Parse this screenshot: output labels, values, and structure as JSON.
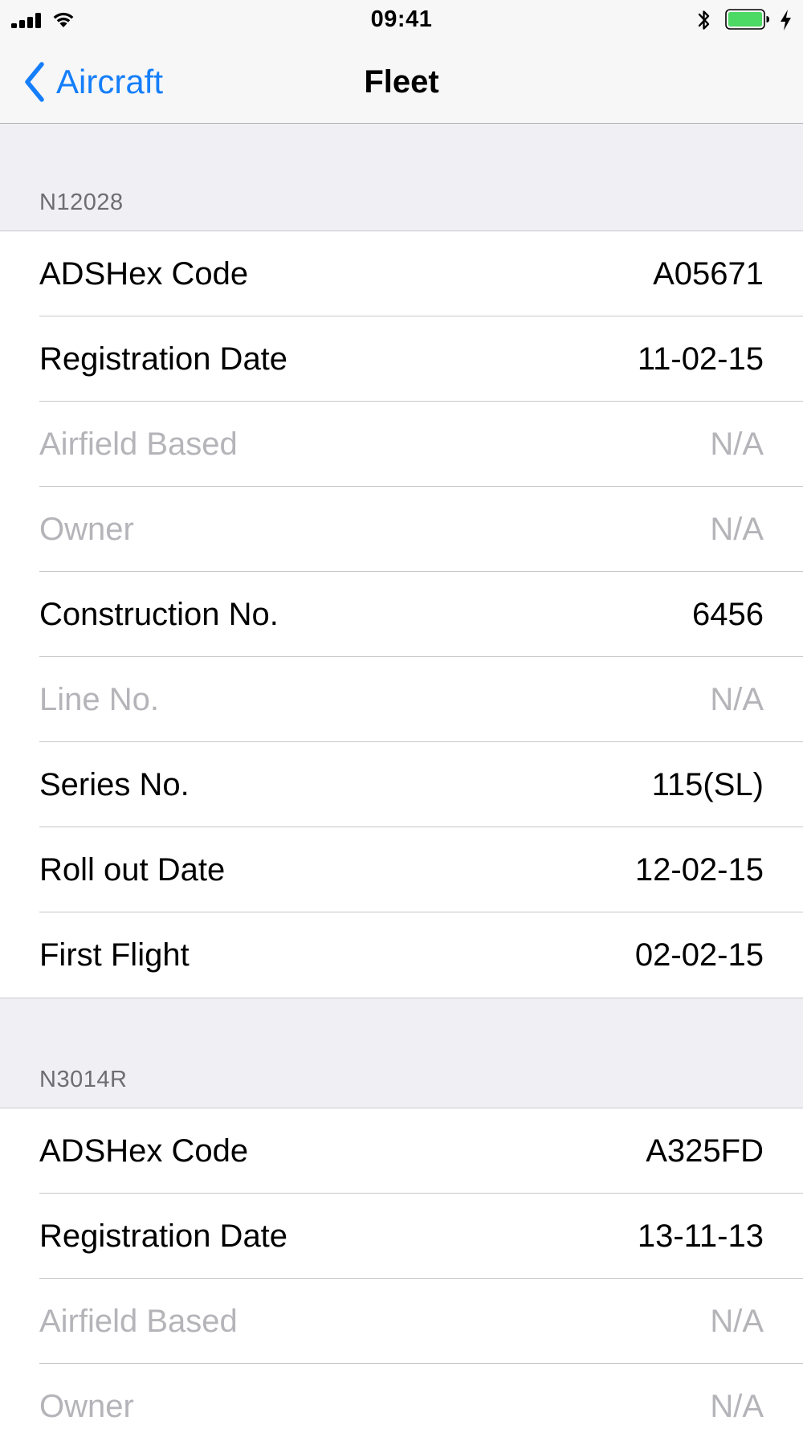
{
  "status_bar": {
    "time": "09:41"
  },
  "nav": {
    "back_label": "Aircraft",
    "title": "Fleet"
  },
  "colors": {
    "accent": "#157efb",
    "battery": "#4cd964",
    "background": "#efeff4",
    "disabled_text": "#b4b4b9"
  },
  "icons": [
    "signal-icon",
    "wifi-icon",
    "bluetooth-icon",
    "battery-icon",
    "charging-icon",
    "back-chevron-icon"
  ],
  "sections": [
    {
      "title": "N12028",
      "rows": [
        {
          "label": "ADSHex Code",
          "value": "A05671"
        },
        {
          "label": "Registration Date",
          "value": "11-02-15"
        },
        {
          "label": "Airfield Based",
          "value": "N/A"
        },
        {
          "label": "Owner",
          "value": "N/A"
        },
        {
          "label": "Construction No.",
          "value": "6456"
        },
        {
          "label": "Line No.",
          "value": "N/A"
        },
        {
          "label": "Series No.",
          "value": "115(SL)"
        },
        {
          "label": "Roll out Date",
          "value": "12-02-15"
        },
        {
          "label": "First Flight",
          "value": "02-02-15"
        }
      ]
    },
    {
      "title": "N3014R",
      "rows": [
        {
          "label": "ADSHex Code",
          "value": "A325FD"
        },
        {
          "label": "Registration Date",
          "value": "13-11-13"
        },
        {
          "label": "Airfield Based",
          "value": "N/A"
        },
        {
          "label": "Owner",
          "value": "N/A"
        }
      ]
    }
  ]
}
